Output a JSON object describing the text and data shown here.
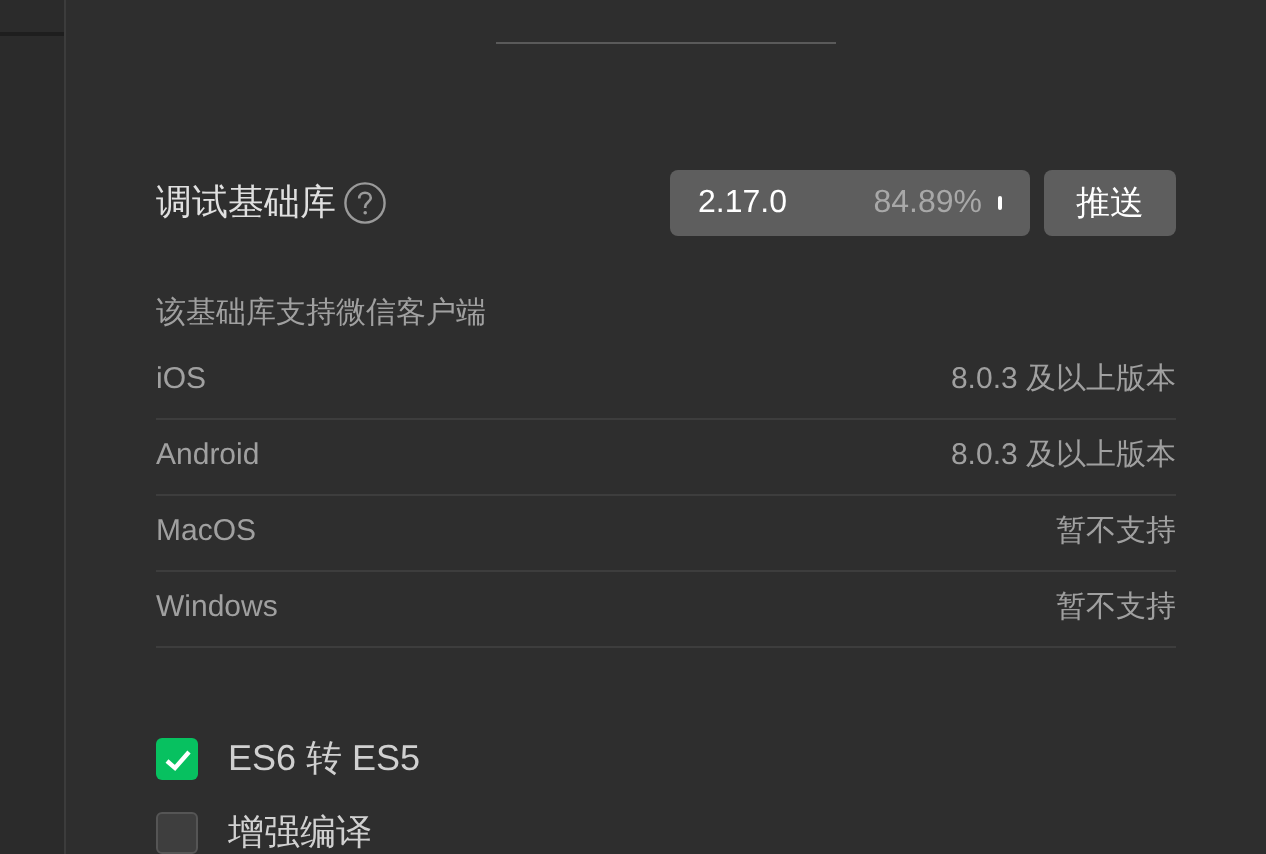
{
  "library": {
    "title": "调试基础库",
    "version": "2.17.0",
    "share": "84.89%",
    "push_button": "推送"
  },
  "support": {
    "caption": "该基础库支持微信客户端",
    "rows": [
      {
        "platform": "iOS",
        "requirement": "8.0.3 及以上版本"
      },
      {
        "platform": "Android",
        "requirement": "8.0.3 及以上版本"
      },
      {
        "platform": "MacOS",
        "requirement": "暂不支持"
      },
      {
        "platform": "Windows",
        "requirement": "暂不支持"
      }
    ]
  },
  "options": [
    {
      "label": "ES6 转 ES5",
      "checked": true
    },
    {
      "label": "增强编译",
      "checked": false
    }
  ]
}
